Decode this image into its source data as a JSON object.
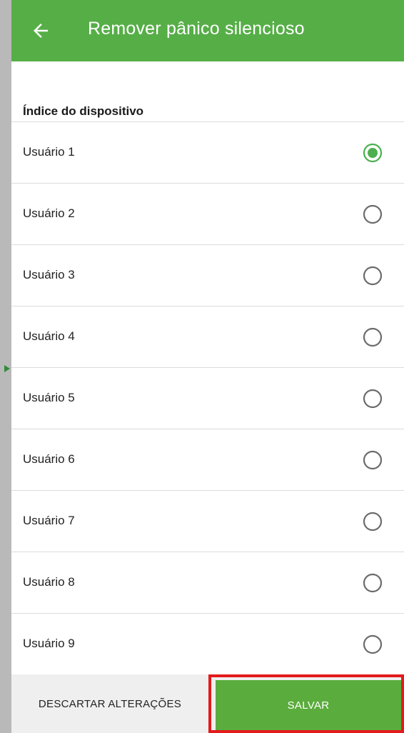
{
  "appbar": {
    "title": "Remover pânico silencioso",
    "back_icon": "arrow-back-icon",
    "color": "#56ae47"
  },
  "section": {
    "header": "Índice do dispositivo"
  },
  "users": [
    {
      "label": "Usuário 1",
      "selected": true
    },
    {
      "label": "Usuário 2",
      "selected": false
    },
    {
      "label": "Usuário 3",
      "selected": false
    },
    {
      "label": "Usuário 4",
      "selected": false
    },
    {
      "label": "Usuário 5",
      "selected": false
    },
    {
      "label": "Usuário 6",
      "selected": false
    },
    {
      "label": "Usuário 7",
      "selected": false
    },
    {
      "label": "Usuário 8",
      "selected": false
    },
    {
      "label": "Usuário 9",
      "selected": false
    }
  ],
  "bottom": {
    "discard_label": "DESCARTAR ALTERAÇÕES",
    "save_label": "SALVAR",
    "highlight_color": "#e31b1b"
  },
  "colors": {
    "accent": "#4caf50",
    "radio_off": "#6b6b6b"
  }
}
